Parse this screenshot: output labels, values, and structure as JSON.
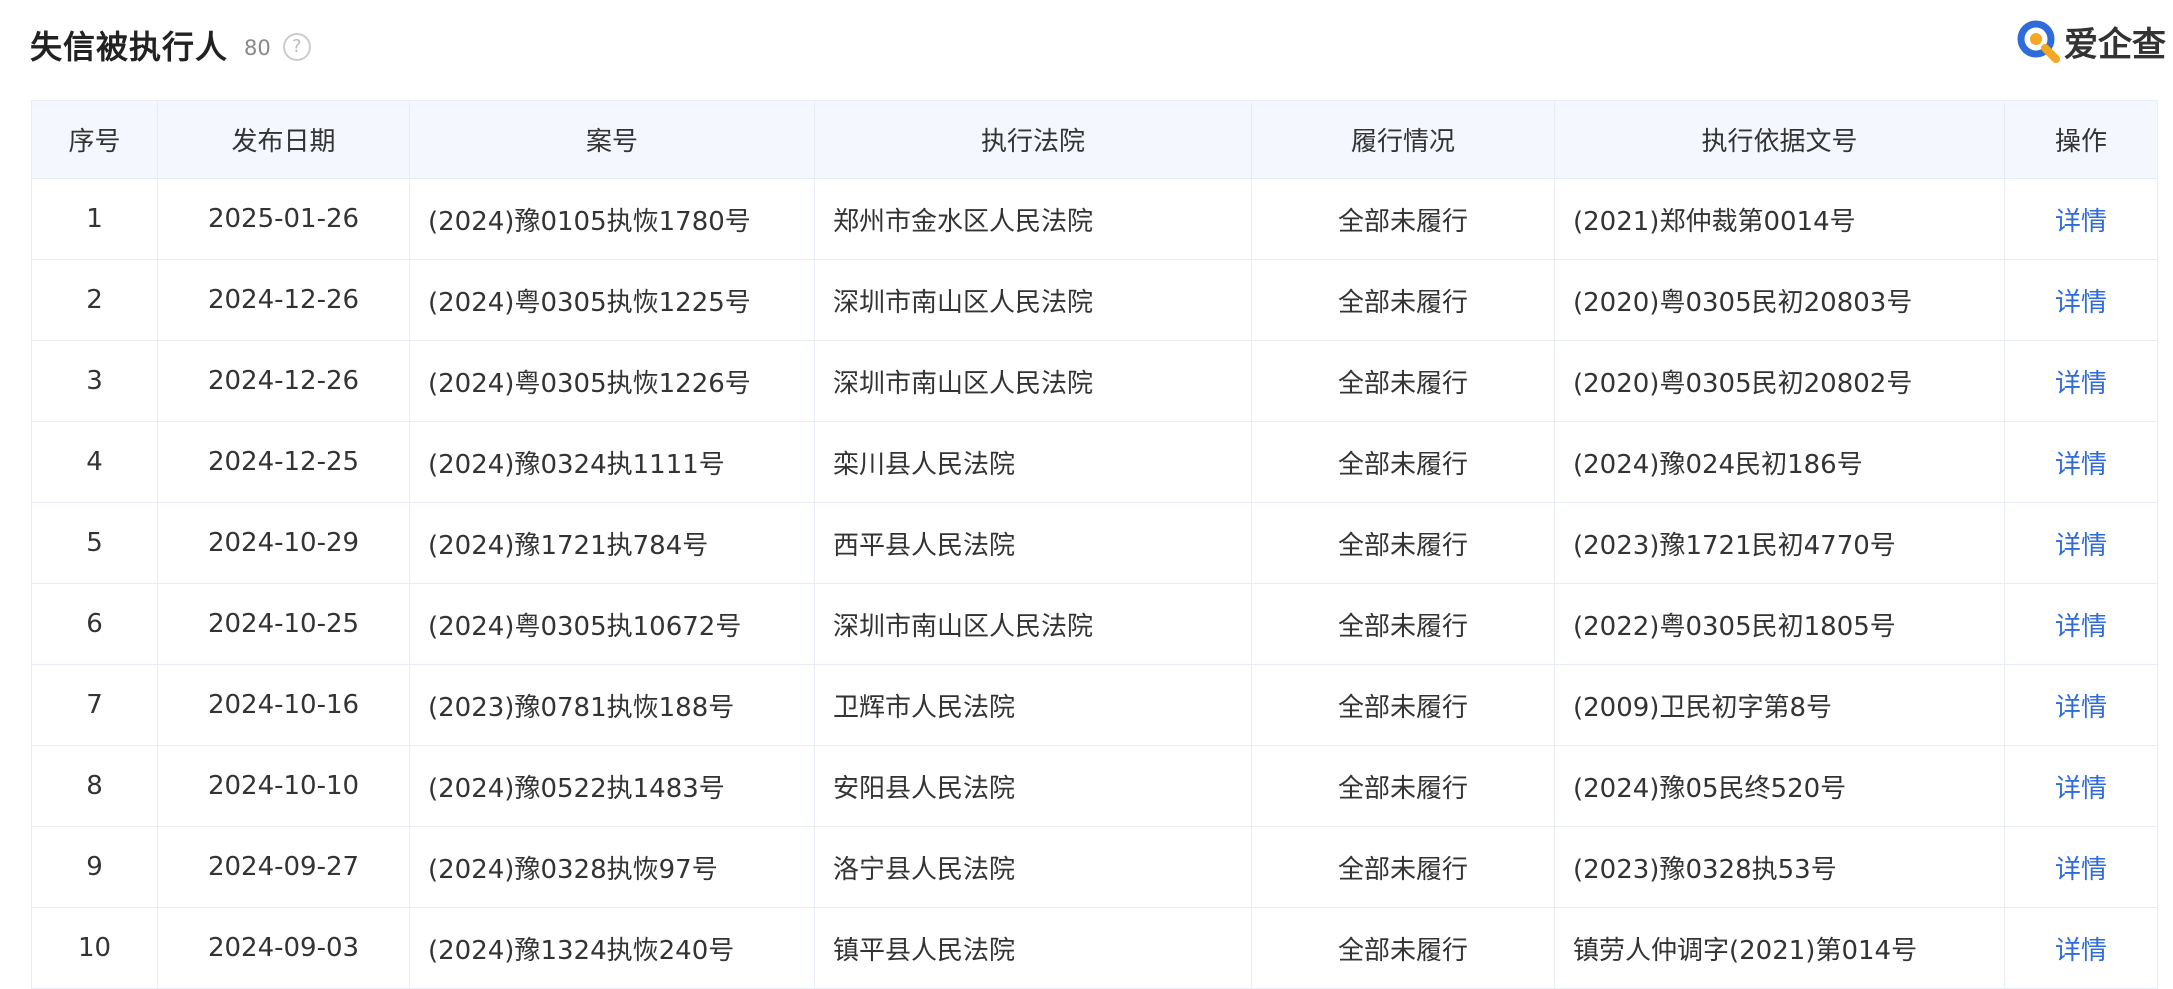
{
  "header": {
    "title": "失信被执行人",
    "count": "80",
    "help_icon": "question-circle-icon"
  },
  "logo": {
    "text": "爱企查",
    "icon": "aiqicha-logo-icon",
    "colors": {
      "blue": "#2f6bd9",
      "orange": "#f5a623"
    }
  },
  "colors": {
    "header_bg": "#f4f7fd",
    "border": "#e8edf5",
    "link": "#2f6bd9"
  },
  "table": {
    "columns": [
      "序号",
      "发布日期",
      "案号",
      "执行法院",
      "履行情况",
      "执行依据文号",
      "操作"
    ],
    "rows": [
      {
        "no": "1",
        "date": "2025-01-26",
        "case": "(2024)豫0105执恢1780号",
        "court": "郑州市金水区人民法院",
        "status": "全部未履行",
        "basis": "(2021)郑仲裁第0014号",
        "action": "详情"
      },
      {
        "no": "2",
        "date": "2024-12-26",
        "case": "(2024)粤0305执恢1225号",
        "court": "深圳市南山区人民法院",
        "status": "全部未履行",
        "basis": "(2020)粤0305民初20803号",
        "action": "详情"
      },
      {
        "no": "3",
        "date": "2024-12-26",
        "case": "(2024)粤0305执恢1226号",
        "court": "深圳市南山区人民法院",
        "status": "全部未履行",
        "basis": "(2020)粤0305民初20802号",
        "action": "详情"
      },
      {
        "no": "4",
        "date": "2024-12-25",
        "case": "(2024)豫0324执1111号",
        "court": "栾川县人民法院",
        "status": "全部未履行",
        "basis": "(2024)豫024民初186号",
        "action": "详情"
      },
      {
        "no": "5",
        "date": "2024-10-29",
        "case": "(2024)豫1721执784号",
        "court": "西平县人民法院",
        "status": "全部未履行",
        "basis": "(2023)豫1721民初4770号",
        "action": "详情"
      },
      {
        "no": "6",
        "date": "2024-10-25",
        "case": "(2024)粤0305执10672号",
        "court": "深圳市南山区人民法院",
        "status": "全部未履行",
        "basis": "(2022)粤0305民初1805号",
        "action": "详情"
      },
      {
        "no": "7",
        "date": "2024-10-16",
        "case": "(2023)豫0781执恢188号",
        "court": "卫辉市人民法院",
        "status": "全部未履行",
        "basis": "(2009)卫民初字第8号",
        "action": "详情"
      },
      {
        "no": "8",
        "date": "2024-10-10",
        "case": "(2024)豫0522执1483号",
        "court": "安阳县人民法院",
        "status": "全部未履行",
        "basis": "(2024)豫05民终520号",
        "action": "详情"
      },
      {
        "no": "9",
        "date": "2024-09-27",
        "case": "(2024)豫0328执恢97号",
        "court": "洛宁县人民法院",
        "status": "全部未履行",
        "basis": "(2023)豫0328执53号",
        "action": "详情"
      },
      {
        "no": "10",
        "date": "2024-09-03",
        "case": "(2024)豫1324执恢240号",
        "court": "镇平县人民法院",
        "status": "全部未履行",
        "basis": "镇劳人仲调字(2021)第014号",
        "action": "详情"
      }
    ]
  }
}
